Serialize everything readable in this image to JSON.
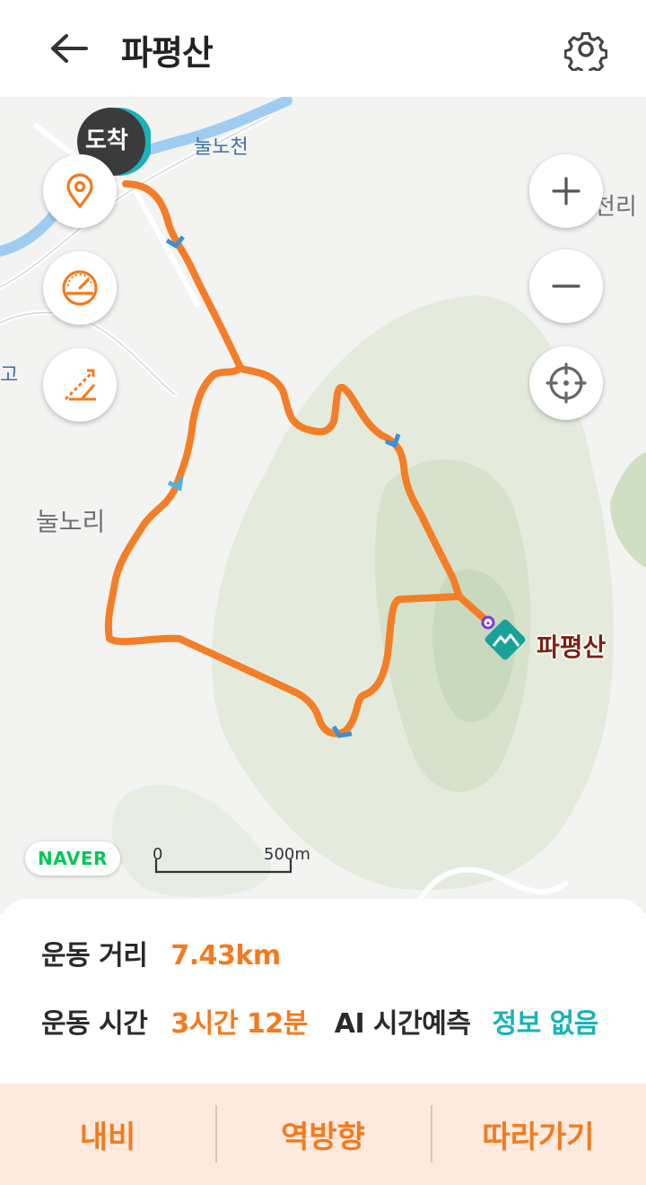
{
  "header": {
    "title": "파평산",
    "back_icon": "arrow-left-icon",
    "settings_icon": "gear-icon"
  },
  "map": {
    "arrival_label": "도착",
    "labels": {
      "river": "눌노천",
      "village": "눌노리",
      "edge_right": "천리",
      "edge_left": "고"
    },
    "peak_name": "파평산",
    "provider": "NAVER",
    "scale_zero": "0",
    "scale_distance": "500m",
    "route_color": "#f47e27",
    "left_controls": [
      "location-pin-icon",
      "speedometer-icon",
      "elevation-slope-icon"
    ],
    "right_controls": [
      "zoom-in-icon",
      "zoom-out-icon",
      "my-location-icon"
    ]
  },
  "stats": {
    "distance_label": "운동 거리",
    "distance_value": "7.43km",
    "time_label": "운동 시간",
    "time_value": "3시간 12분",
    "ai_label": "AI 시간예측",
    "ai_value": "정보 없음"
  },
  "actions": {
    "navi": "내비",
    "reverse": "역방향",
    "follow": "따라가기"
  }
}
